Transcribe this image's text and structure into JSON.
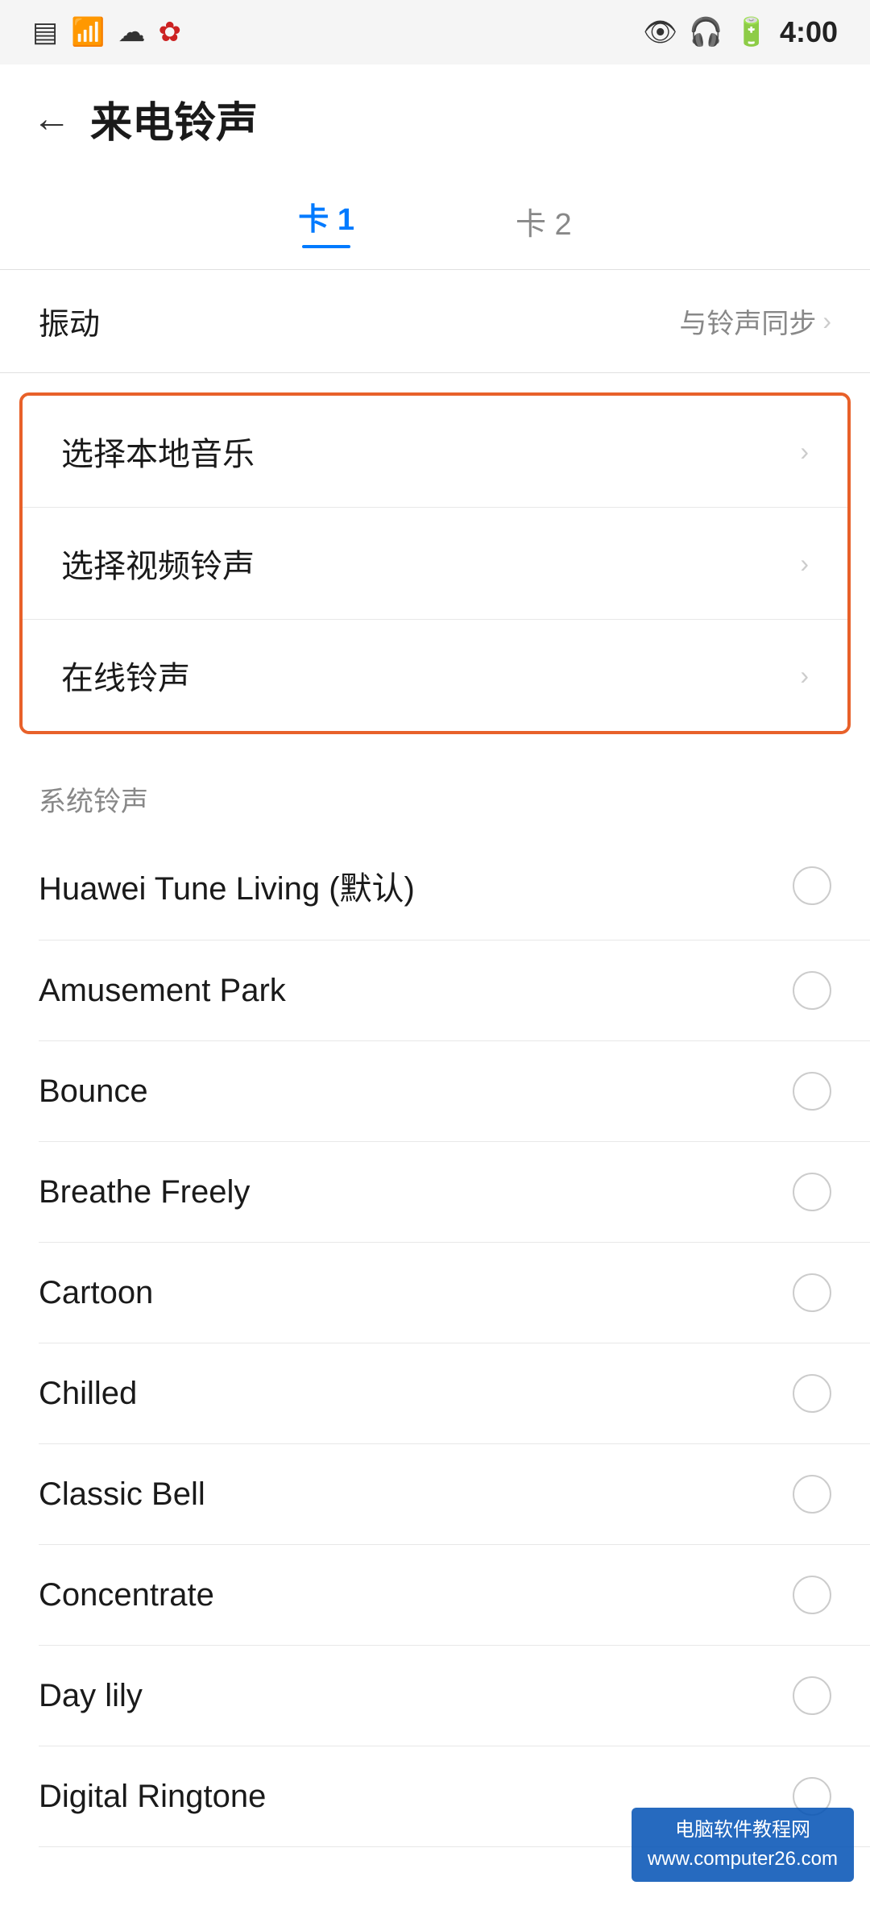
{
  "statusBar": {
    "time": "4:00",
    "leftIcons": [
      "sim-icon",
      "wifi-icon",
      "cloud-icon",
      "huawei-icon"
    ],
    "rightIcons": [
      "eye-icon",
      "headphone-icon",
      "battery-icon",
      "signal-icon"
    ]
  },
  "header": {
    "backLabel": "←",
    "title": "来电铃声"
  },
  "tabs": [
    {
      "label": "卡 1",
      "active": true
    },
    {
      "label": "卡 2",
      "active": false
    }
  ],
  "vibration": {
    "label": "振动",
    "value": "与铃声同步",
    "chevron": "›"
  },
  "highlightedOptions": [
    {
      "label": "选择本地音乐",
      "chevron": "›"
    },
    {
      "label": "选择视频铃声",
      "chevron": "›"
    },
    {
      "label": "在线铃声",
      "chevron": "›"
    }
  ],
  "sectionHeader": "系统铃声",
  "ringtones": [
    {
      "name": "Huawei Tune Living (默认)",
      "selected": false
    },
    {
      "name": "Amusement Park",
      "selected": false
    },
    {
      "name": "Bounce",
      "selected": false
    },
    {
      "name": "Breathe Freely",
      "selected": false
    },
    {
      "name": "Cartoon",
      "selected": false
    },
    {
      "name": "Chilled",
      "selected": false
    },
    {
      "name": "Classic Bell",
      "selected": false
    },
    {
      "name": "Concentrate",
      "selected": false
    },
    {
      "name": "Day lily",
      "selected": false
    },
    {
      "name": "Digital Ringtone",
      "selected": false
    }
  ],
  "watermark": "电脑软件教程网\nwww.computer26.com"
}
